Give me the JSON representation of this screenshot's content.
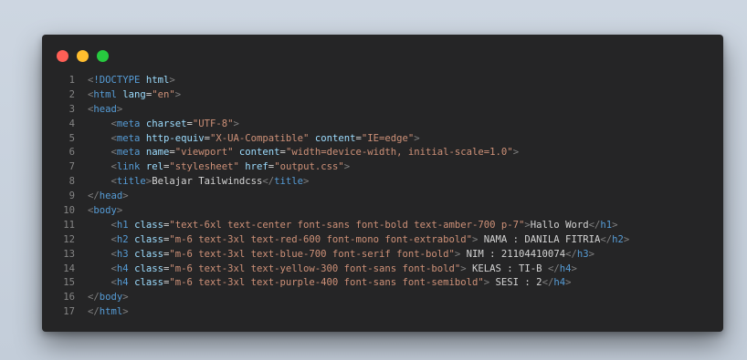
{
  "window": {
    "controls": [
      "close",
      "minimize",
      "maximize"
    ]
  },
  "colors": {
    "tag": "#569cd6",
    "attr": "#9cdcfe",
    "string": "#ce9178",
    "text": "#d4d4d4",
    "punct": "#808080",
    "line_number": "#858585"
  },
  "code": {
    "lines": [
      {
        "n": "1",
        "indent": "",
        "tokens": [
          {
            "t": "punct",
            "v": "<"
          },
          {
            "t": "doctype",
            "v": "!DOCTYPE"
          },
          {
            "t": "text",
            "v": " "
          },
          {
            "t": "attr",
            "v": "html"
          },
          {
            "t": "punct",
            "v": ">"
          }
        ]
      },
      {
        "n": "2",
        "indent": "",
        "tokens": [
          {
            "t": "punct",
            "v": "<"
          },
          {
            "t": "tag",
            "v": "html"
          },
          {
            "t": "text",
            "v": " "
          },
          {
            "t": "attr",
            "v": "lang"
          },
          {
            "t": "text",
            "v": "="
          },
          {
            "t": "str",
            "v": "\"en\""
          },
          {
            "t": "punct",
            "v": ">"
          }
        ]
      },
      {
        "n": "3",
        "indent": "",
        "tokens": [
          {
            "t": "punct",
            "v": "<"
          },
          {
            "t": "tag",
            "v": "head"
          },
          {
            "t": "punct",
            "v": ">"
          }
        ]
      },
      {
        "n": "4",
        "indent": "    ",
        "tokens": [
          {
            "t": "punct",
            "v": "<"
          },
          {
            "t": "tag",
            "v": "meta"
          },
          {
            "t": "text",
            "v": " "
          },
          {
            "t": "attr",
            "v": "charset"
          },
          {
            "t": "text",
            "v": "="
          },
          {
            "t": "str",
            "v": "\"UTF-8\""
          },
          {
            "t": "punct",
            "v": ">"
          }
        ]
      },
      {
        "n": "5",
        "indent": "    ",
        "tokens": [
          {
            "t": "punct",
            "v": "<"
          },
          {
            "t": "tag",
            "v": "meta"
          },
          {
            "t": "text",
            "v": " "
          },
          {
            "t": "attr",
            "v": "http-equiv"
          },
          {
            "t": "text",
            "v": "="
          },
          {
            "t": "str",
            "v": "\"X-UA-Compatible\""
          },
          {
            "t": "text",
            "v": " "
          },
          {
            "t": "attr",
            "v": "content"
          },
          {
            "t": "text",
            "v": "="
          },
          {
            "t": "str",
            "v": "\"IE=edge\""
          },
          {
            "t": "punct",
            "v": ">"
          }
        ]
      },
      {
        "n": "6",
        "indent": "    ",
        "tokens": [
          {
            "t": "punct",
            "v": "<"
          },
          {
            "t": "tag",
            "v": "meta"
          },
          {
            "t": "text",
            "v": " "
          },
          {
            "t": "attr",
            "v": "name"
          },
          {
            "t": "text",
            "v": "="
          },
          {
            "t": "str",
            "v": "\"viewport\""
          },
          {
            "t": "text",
            "v": " "
          },
          {
            "t": "attr",
            "v": "content"
          },
          {
            "t": "text",
            "v": "="
          },
          {
            "t": "str",
            "v": "\"width=device-width, initial-scale=1.0\""
          },
          {
            "t": "punct",
            "v": ">"
          }
        ]
      },
      {
        "n": "7",
        "indent": "    ",
        "tokens": [
          {
            "t": "punct",
            "v": "<"
          },
          {
            "t": "tag",
            "v": "link"
          },
          {
            "t": "text",
            "v": " "
          },
          {
            "t": "attr",
            "v": "rel"
          },
          {
            "t": "text",
            "v": "="
          },
          {
            "t": "str",
            "v": "\"stylesheet\""
          },
          {
            "t": "text",
            "v": " "
          },
          {
            "t": "attr",
            "v": "href"
          },
          {
            "t": "text",
            "v": "="
          },
          {
            "t": "str",
            "v": "\"output.css\""
          },
          {
            "t": "punct",
            "v": ">"
          }
        ]
      },
      {
        "n": "8",
        "indent": "    ",
        "tokens": [
          {
            "t": "punct",
            "v": "<"
          },
          {
            "t": "tag",
            "v": "title"
          },
          {
            "t": "punct",
            "v": ">"
          },
          {
            "t": "text",
            "v": "Belajar Tailwindcss"
          },
          {
            "t": "punct",
            "v": "</"
          },
          {
            "t": "tag",
            "v": "title"
          },
          {
            "t": "punct",
            "v": ">"
          }
        ]
      },
      {
        "n": "9",
        "indent": "",
        "tokens": [
          {
            "t": "punct",
            "v": "</"
          },
          {
            "t": "tag",
            "v": "head"
          },
          {
            "t": "punct",
            "v": ">"
          }
        ]
      },
      {
        "n": "10",
        "indent": "",
        "tokens": [
          {
            "t": "punct",
            "v": "<"
          },
          {
            "t": "tag",
            "v": "body"
          },
          {
            "t": "punct",
            "v": ">"
          }
        ]
      },
      {
        "n": "11",
        "indent": "    ",
        "tokens": [
          {
            "t": "punct",
            "v": "<"
          },
          {
            "t": "tag",
            "v": "h1"
          },
          {
            "t": "text",
            "v": " "
          },
          {
            "t": "attr",
            "v": "class"
          },
          {
            "t": "text",
            "v": "="
          },
          {
            "t": "str",
            "v": "\"text-6xl text-center font-sans font-bold text-amber-700 p-7\""
          },
          {
            "t": "punct",
            "v": ">"
          },
          {
            "t": "text",
            "v": "Hallo Word"
          },
          {
            "t": "punct",
            "v": "</"
          },
          {
            "t": "tag",
            "v": "h1"
          },
          {
            "t": "punct",
            "v": ">"
          }
        ]
      },
      {
        "n": "12",
        "indent": "    ",
        "tokens": [
          {
            "t": "punct",
            "v": "<"
          },
          {
            "t": "tag",
            "v": "h2"
          },
          {
            "t": "text",
            "v": " "
          },
          {
            "t": "attr",
            "v": "class"
          },
          {
            "t": "text",
            "v": "="
          },
          {
            "t": "str",
            "v": "\"m-6 text-3xl text-red-600 font-mono font-extrabold\""
          },
          {
            "t": "punct",
            "v": ">"
          },
          {
            "t": "text",
            "v": " NAMA : DANILA FITRIA"
          },
          {
            "t": "punct",
            "v": "</"
          },
          {
            "t": "tag",
            "v": "h2"
          },
          {
            "t": "punct",
            "v": ">"
          }
        ]
      },
      {
        "n": "13",
        "indent": "    ",
        "tokens": [
          {
            "t": "punct",
            "v": "<"
          },
          {
            "t": "tag",
            "v": "h3"
          },
          {
            "t": "text",
            "v": " "
          },
          {
            "t": "attr",
            "v": "class"
          },
          {
            "t": "text",
            "v": "="
          },
          {
            "t": "str",
            "v": "\"m-6 text-3xl text-blue-700 font-serif font-bold\""
          },
          {
            "t": "punct",
            "v": ">"
          },
          {
            "t": "text",
            "v": " NIM : 21104410074"
          },
          {
            "t": "punct",
            "v": "</"
          },
          {
            "t": "tag",
            "v": "h3"
          },
          {
            "t": "punct",
            "v": ">"
          }
        ]
      },
      {
        "n": "14",
        "indent": "    ",
        "tokens": [
          {
            "t": "punct",
            "v": "<"
          },
          {
            "t": "tag",
            "v": "h4"
          },
          {
            "t": "text",
            "v": " "
          },
          {
            "t": "attr",
            "v": "class"
          },
          {
            "t": "text",
            "v": "="
          },
          {
            "t": "str",
            "v": "\"m-6 text-3xl text-yellow-300 font-sans font-bold\""
          },
          {
            "t": "punct",
            "v": ">"
          },
          {
            "t": "text",
            "v": " KELAS : TI-B "
          },
          {
            "t": "punct",
            "v": "</"
          },
          {
            "t": "tag",
            "v": "h4"
          },
          {
            "t": "punct",
            "v": ">"
          }
        ]
      },
      {
        "n": "15",
        "indent": "    ",
        "tokens": [
          {
            "t": "punct",
            "v": "<"
          },
          {
            "t": "tag",
            "v": "h4"
          },
          {
            "t": "text",
            "v": " "
          },
          {
            "t": "attr",
            "v": "class"
          },
          {
            "t": "text",
            "v": "="
          },
          {
            "t": "str",
            "v": "\"m-6 text-3xl text-purple-400 font-sans font-semibold\""
          },
          {
            "t": "punct",
            "v": ">"
          },
          {
            "t": "text",
            "v": " SESI : 2"
          },
          {
            "t": "punct",
            "v": "</"
          },
          {
            "t": "tag",
            "v": "h4"
          },
          {
            "t": "punct",
            "v": ">"
          }
        ]
      },
      {
        "n": "16",
        "indent": "",
        "tokens": [
          {
            "t": "punct",
            "v": "</"
          },
          {
            "t": "tag",
            "v": "body"
          },
          {
            "t": "punct",
            "v": ">"
          }
        ]
      },
      {
        "n": "17",
        "indent": "",
        "tokens": [
          {
            "t": "punct",
            "v": "</"
          },
          {
            "t": "tag",
            "v": "html"
          },
          {
            "t": "punct",
            "v": ">"
          }
        ]
      }
    ]
  }
}
